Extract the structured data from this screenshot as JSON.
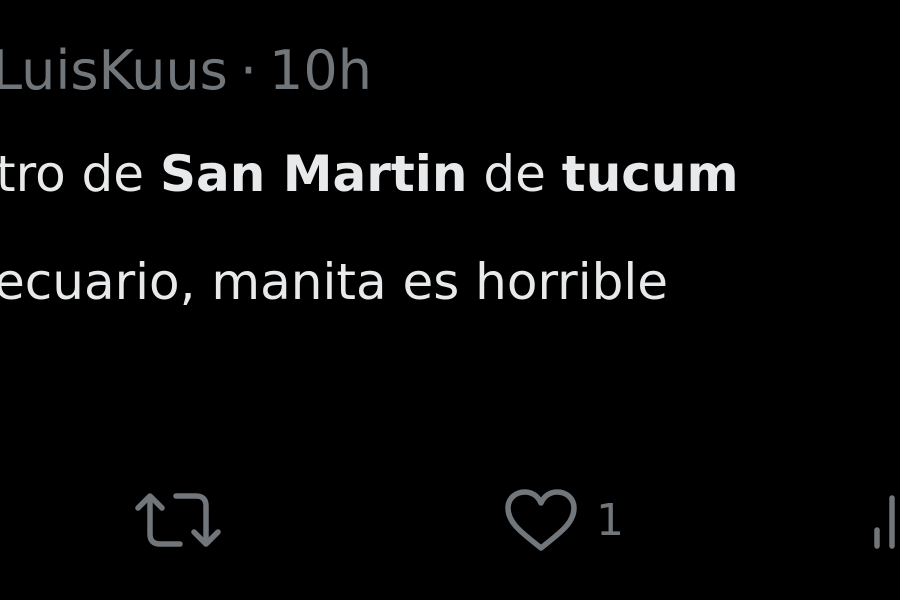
{
  "tweet": {
    "header": {
      "handle": "LuisKuus",
      "separator": "·",
      "time": "10h"
    },
    "text": {
      "line1": {
        "part1": "tro de ",
        "bold1": "San Martin",
        "part2": " de ",
        "bold2": "tucum"
      },
      "line2": "ecuario, manita es horrible"
    },
    "actions": {
      "retweet_icon": "retweet-icon",
      "like_icon": "heart-icon",
      "like_count": "1",
      "views_icon": "views-icon"
    }
  },
  "colors": {
    "background": "#000000",
    "text": "#e7e9ea",
    "secondary": "#71767b"
  }
}
